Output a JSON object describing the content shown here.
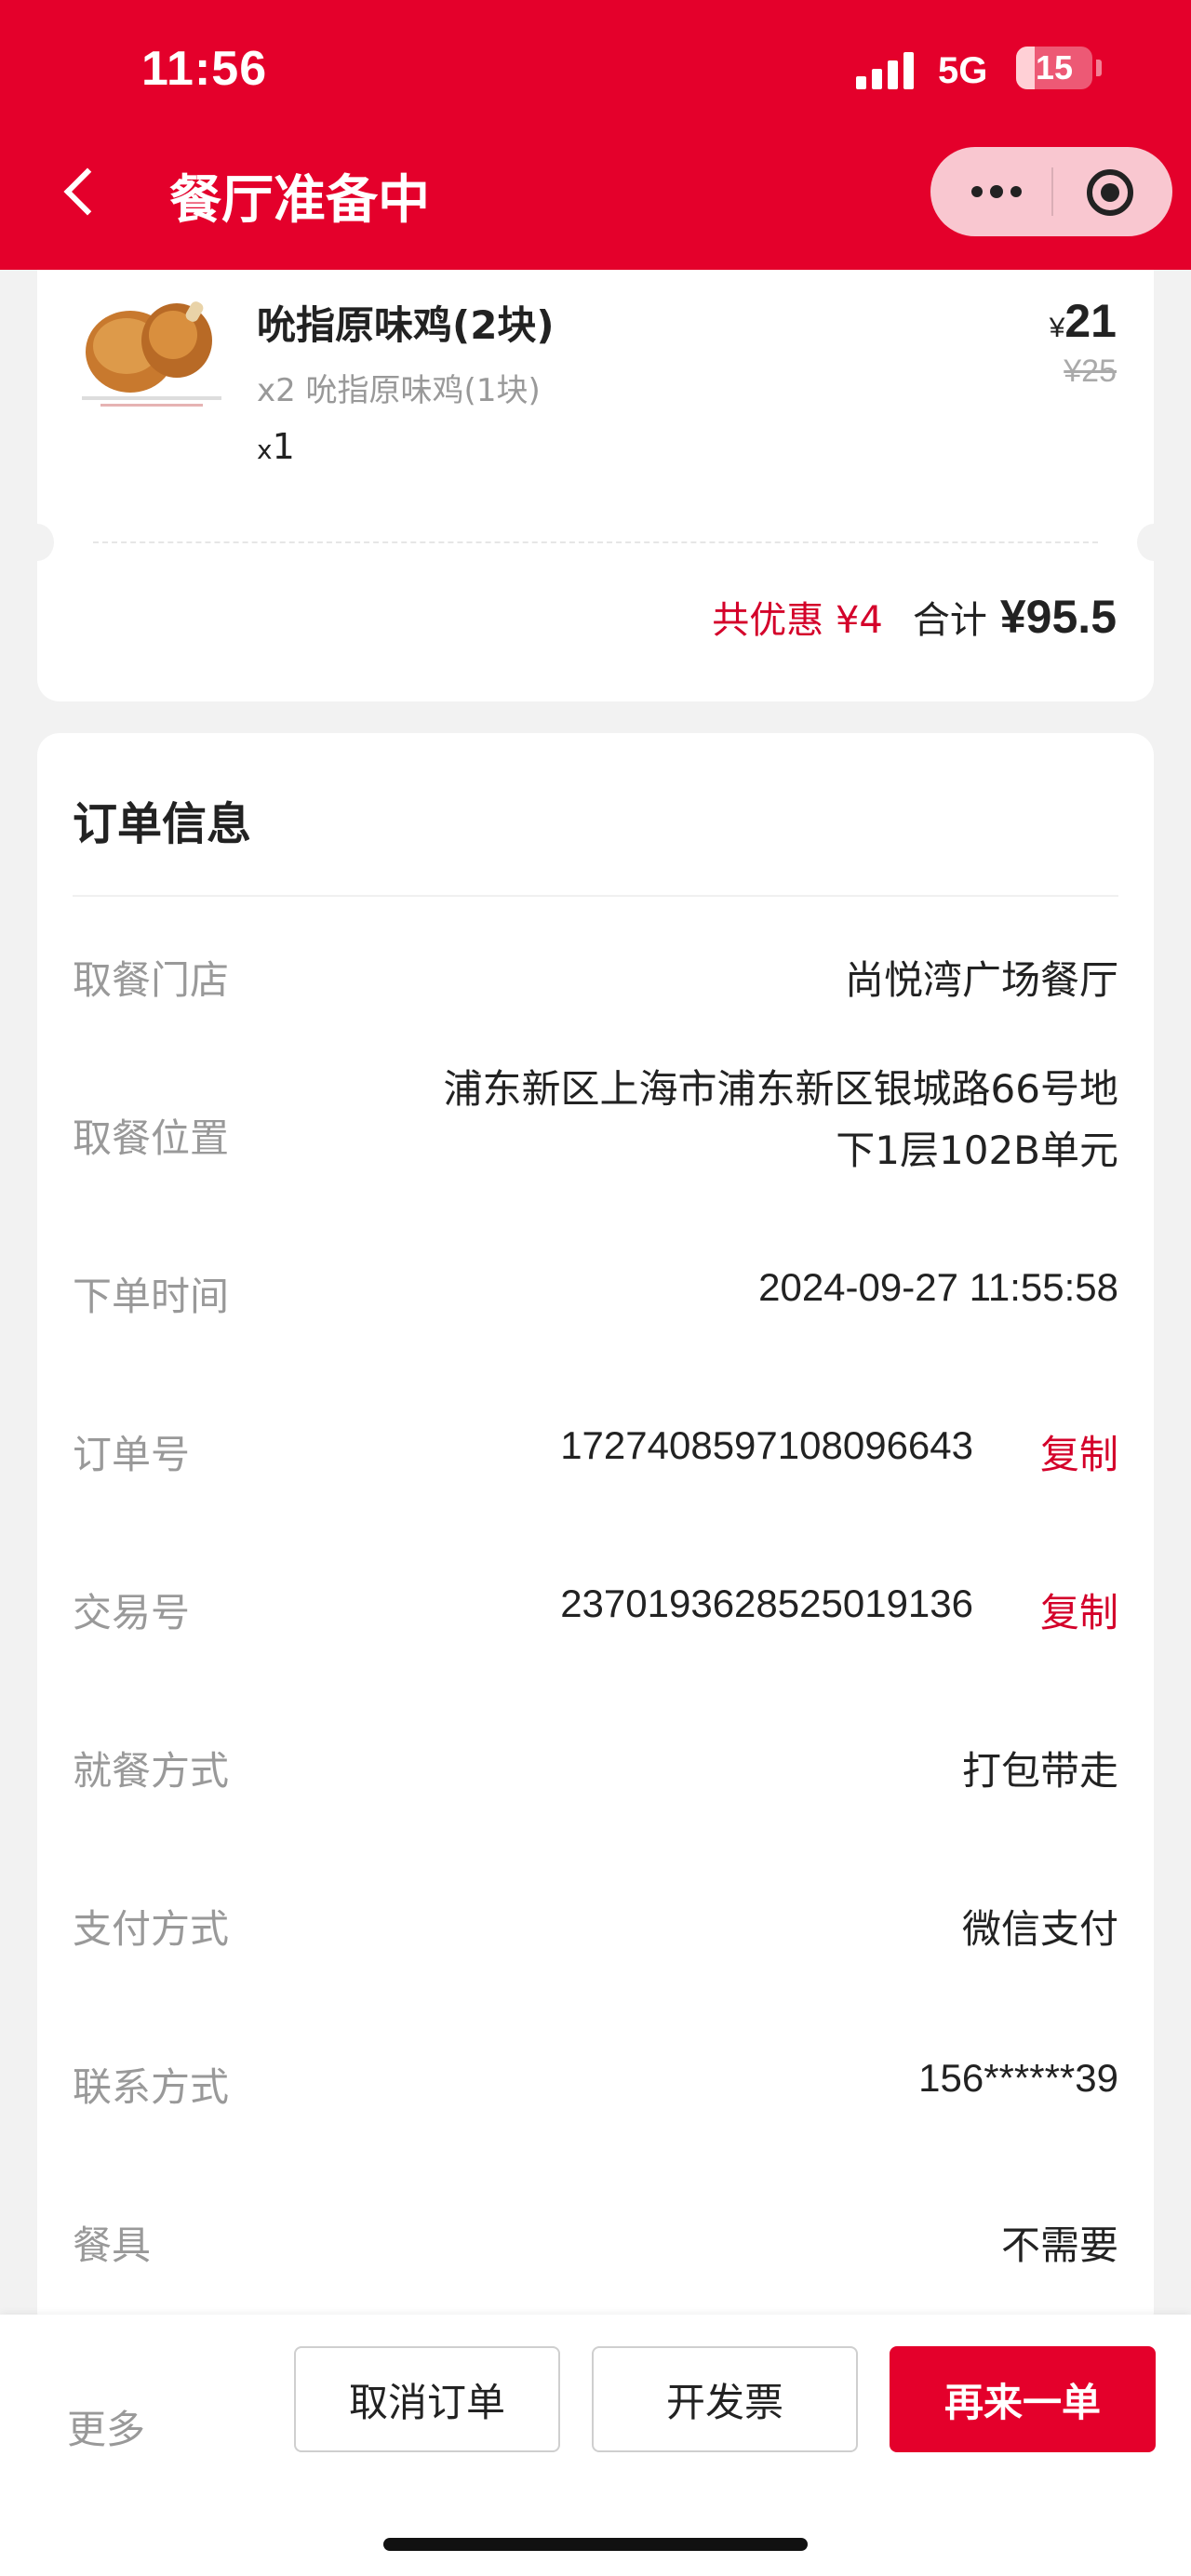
{
  "status_bar": {
    "time": "11:56",
    "network": "5G",
    "battery": "15"
  },
  "header": {
    "title": "餐厅准备中",
    "back_icon": "chevron-left-icon",
    "menu_icon": "more-dots-icon",
    "close_icon": "target-circle-icon",
    "color": "#e4002b"
  },
  "order_item": {
    "name": "吮指原味鸡(2块)",
    "sub": "x2 吮指原味鸡(1块)",
    "qty_prefix": "x",
    "qty": "1",
    "price_symbol": "¥",
    "price": "21",
    "original_price": "¥25"
  },
  "summary": {
    "discount": "共优惠 ¥4",
    "total_label": "合计",
    "total": "¥95.5"
  },
  "order_info": {
    "title": "订单信息",
    "store_label": "取餐门店",
    "store_value": "尚悦湾广场餐厅",
    "location_label": "取餐位置",
    "location_line1": "浦东新区上海市浦东新区银城路66号地",
    "location_line2": "下1层102B单元",
    "time_label": "下单时间",
    "time_value": "2024-09-27 11:55:58",
    "order_no_label": "订单号",
    "order_no_value": "1727408597108096643",
    "trade_no_label": "交易号",
    "trade_no_value": "2370193628525019136",
    "copy_label": "复制",
    "dining_label": "就餐方式",
    "dining_value": "打包带走",
    "pay_label": "支付方式",
    "pay_value": "微信支付",
    "contact_label": "联系方式",
    "contact_value": "156******39",
    "utensils_label": "餐具",
    "utensils_value": "不需要"
  },
  "bottom_bar": {
    "more": "更多",
    "cancel": "取消订单",
    "invoice": "开发票",
    "reorder": "再来一单"
  }
}
